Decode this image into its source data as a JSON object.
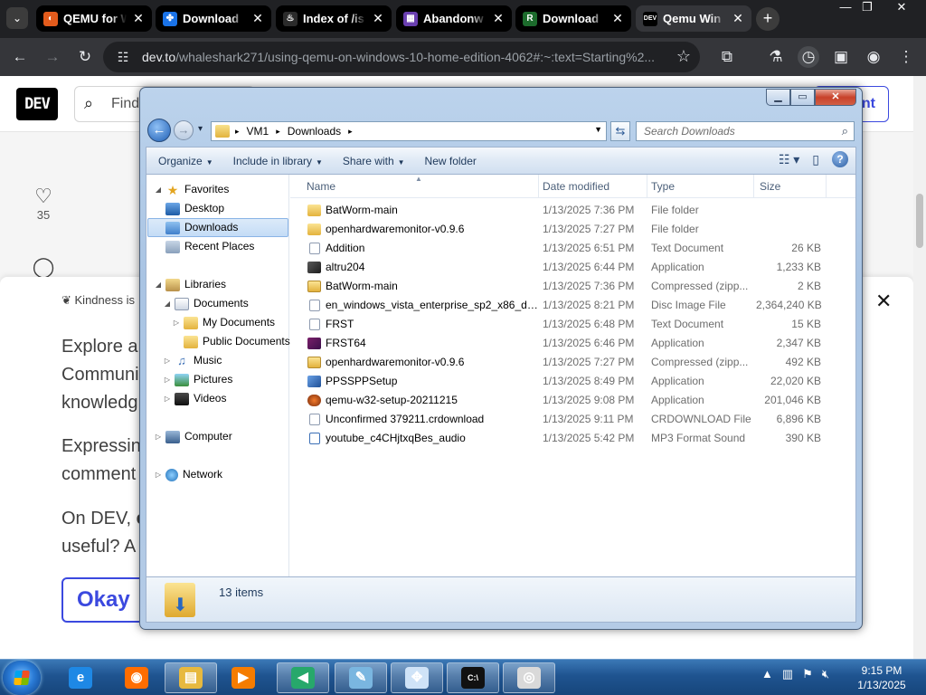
{
  "browser": {
    "tabs": [
      {
        "title": "QEMU for W",
        "favicon": "qemu-icon",
        "active": false
      },
      {
        "title": "Download",
        "favicon": "pinwheel-icon",
        "active": false
      },
      {
        "title": "Index of /is",
        "favicon": "steam-icon",
        "active": false
      },
      {
        "title": "Abandonw",
        "favicon": "abandonware-icon",
        "active": false
      },
      {
        "title": "Download",
        "favicon": "roms-icon",
        "active": false
      },
      {
        "title": "Qemu Win",
        "favicon": "dev-icon",
        "active": true
      }
    ],
    "close_glyph": "✕",
    "newtab_glyph": "+",
    "url_host": "dev.to",
    "url_path": "/whaleshark271/using-qemu-on-windows-10-home-edition-4062#:~:text=Starting%2...",
    "window_controls": {
      "minimize": "—",
      "maximize": "❐",
      "close": "✕"
    }
  },
  "devto": {
    "logo": "DEV",
    "search_placeholder": "Find",
    "create_label": "nt",
    "heart_count": "35",
    "kindness_text": "Kindness is",
    "para1": [
      "Explore a",
      "Communi",
      "knowledg"
    ],
    "para2": [
      "Expressing",
      "comment"
    ],
    "para3_a": "On DEV, ",
    "para3_b": "e",
    "para3_c": "useful? A",
    "ok_label": "Okay"
  },
  "explorer": {
    "address": [
      "VM1",
      "Downloads"
    ],
    "search_placeholder": "Search Downloads",
    "commands": [
      {
        "label": "Organize",
        "arrow": true
      },
      {
        "label": "Include in library",
        "arrow": true
      },
      {
        "label": "Share with",
        "arrow": true
      },
      {
        "label": "New folder",
        "arrow": false
      }
    ],
    "nav": {
      "favorites": "Favorites",
      "desktop": "Desktop",
      "downloads": "Downloads",
      "recent": "Recent Places",
      "libraries": "Libraries",
      "documents": "Documents",
      "my_documents": "My Documents",
      "public_documents": "Public Documents",
      "music": "Music",
      "pictures": "Pictures",
      "videos": "Videos",
      "computer": "Computer",
      "network": "Network"
    },
    "columns": {
      "name": "Name",
      "date": "Date modified",
      "type": "Type",
      "size": "Size"
    },
    "files": [
      {
        "name": "BatWorm-main",
        "date": "1/13/2025 7:36 PM",
        "type": "File folder",
        "size": "",
        "icon": "folder"
      },
      {
        "name": "openhardwaremonitor-v0.9.6",
        "date": "1/13/2025 7:27 PM",
        "type": "File folder",
        "size": "",
        "icon": "folder"
      },
      {
        "name": "Addition",
        "date": "1/13/2025 6:51 PM",
        "type": "Text Document",
        "size": "26 KB",
        "icon": "txt"
      },
      {
        "name": "altru204",
        "date": "1/13/2025 6:44 PM",
        "type": "Application",
        "size": "1,233 KB",
        "icon": "app"
      },
      {
        "name": "BatWorm-main",
        "date": "1/13/2025 7:36 PM",
        "type": "Compressed (zipp...",
        "size": "2 KB",
        "icon": "zip"
      },
      {
        "name": "en_windows_vista_enterprise_sp2_x86_dv...",
        "date": "1/13/2025 8:21 PM",
        "type": "Disc Image File",
        "size": "2,364,240 KB",
        "icon": "iso"
      },
      {
        "name": "FRST",
        "date": "1/13/2025 6:48 PM",
        "type": "Text Document",
        "size": "15 KB",
        "icon": "txt"
      },
      {
        "name": "FRST64",
        "date": "1/13/2025 6:46 PM",
        "type": "Application",
        "size": "2,347 KB",
        "icon": "frst64"
      },
      {
        "name": "openhardwaremonitor-v0.9.6",
        "date": "1/13/2025 7:27 PM",
        "type": "Compressed (zipp...",
        "size": "492 KB",
        "icon": "zip"
      },
      {
        "name": "PPSSPPSetup",
        "date": "1/13/2025 8:49 PM",
        "type": "Application",
        "size": "22,020 KB",
        "icon": "ppsspp"
      },
      {
        "name": "qemu-w32-setup-20211215",
        "date": "1/13/2025 9:08 PM",
        "type": "Application",
        "size": "201,046 KB",
        "icon": "qemu"
      },
      {
        "name": "Unconfirmed 379211.crdownload",
        "date": "1/13/2025 9:11 PM",
        "type": "CRDOWNLOAD File",
        "size": "6,896 KB",
        "icon": "crd"
      },
      {
        "name": "youtube_c4CHjtxqBes_audio",
        "date": "1/13/2025 5:42 PM",
        "type": "MP3 Format Sound",
        "size": "390 KB",
        "icon": "mp3"
      }
    ],
    "item_count": "13 items"
  },
  "taskbar": {
    "items": [
      {
        "name": "ie",
        "glyph": "e",
        "color": "#1e88e5",
        "running": false
      },
      {
        "name": "firefox",
        "glyph": "◉",
        "color": "#ff6d00",
        "running": false
      },
      {
        "name": "explorer",
        "glyph": "▤",
        "color": "#e7b93f",
        "running": true
      },
      {
        "name": "media",
        "glyph": "▶",
        "color": "#f57c00",
        "running": false
      },
      {
        "name": "player",
        "glyph": "◀",
        "color": "#27a86b",
        "running": true
      },
      {
        "name": "notepad",
        "glyph": "✎",
        "color": "#7ab6e0",
        "running": true
      },
      {
        "name": "network-app",
        "glyph": "✥",
        "color": "#cfe3f7",
        "running": true
      },
      {
        "name": "cmd",
        "glyph": "C:\\",
        "color": "#111111",
        "running": true
      },
      {
        "name": "disc",
        "glyph": "◎",
        "color": "#d9d9d9",
        "running": true
      }
    ],
    "time": "9:15 PM",
    "date": "1/13/2025"
  }
}
